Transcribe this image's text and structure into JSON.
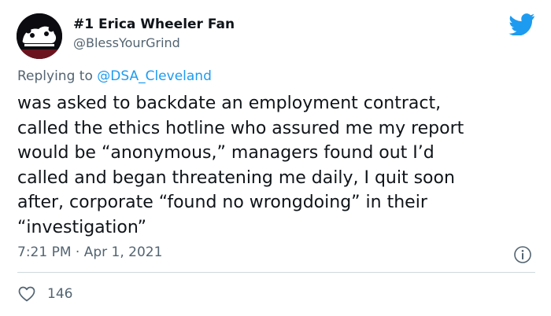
{
  "author": {
    "display_name": "#1 Erica Wheeler Fan",
    "handle": "@BlessYourGrind",
    "avatar": "panda-logo-avatar"
  },
  "reply": {
    "prefix": "Replying to",
    "mention": "@DSA_Cleveland"
  },
  "tweet": {
    "lines": [
      "was asked to backdate an employment contract,",
      "called the ethics hotline who assured me my report",
      "would be “anonymous,” managers found out I’d",
      "called and began threatening me daily, I quit soon",
      "after, corporate “found no wrongdoing” in their",
      "“investigation”"
    ],
    "time": "7:21 PM",
    "separator": "·",
    "date": "Apr 1, 2021"
  },
  "engagement": {
    "likes": "146"
  },
  "icons": {
    "brand": "twitter-bird-icon",
    "info": "info-icon",
    "like": "heart-icon"
  },
  "colors": {
    "brand_blue": "#1d9bf0",
    "secondary_text": "#536471",
    "divider": "#cfd9de"
  }
}
